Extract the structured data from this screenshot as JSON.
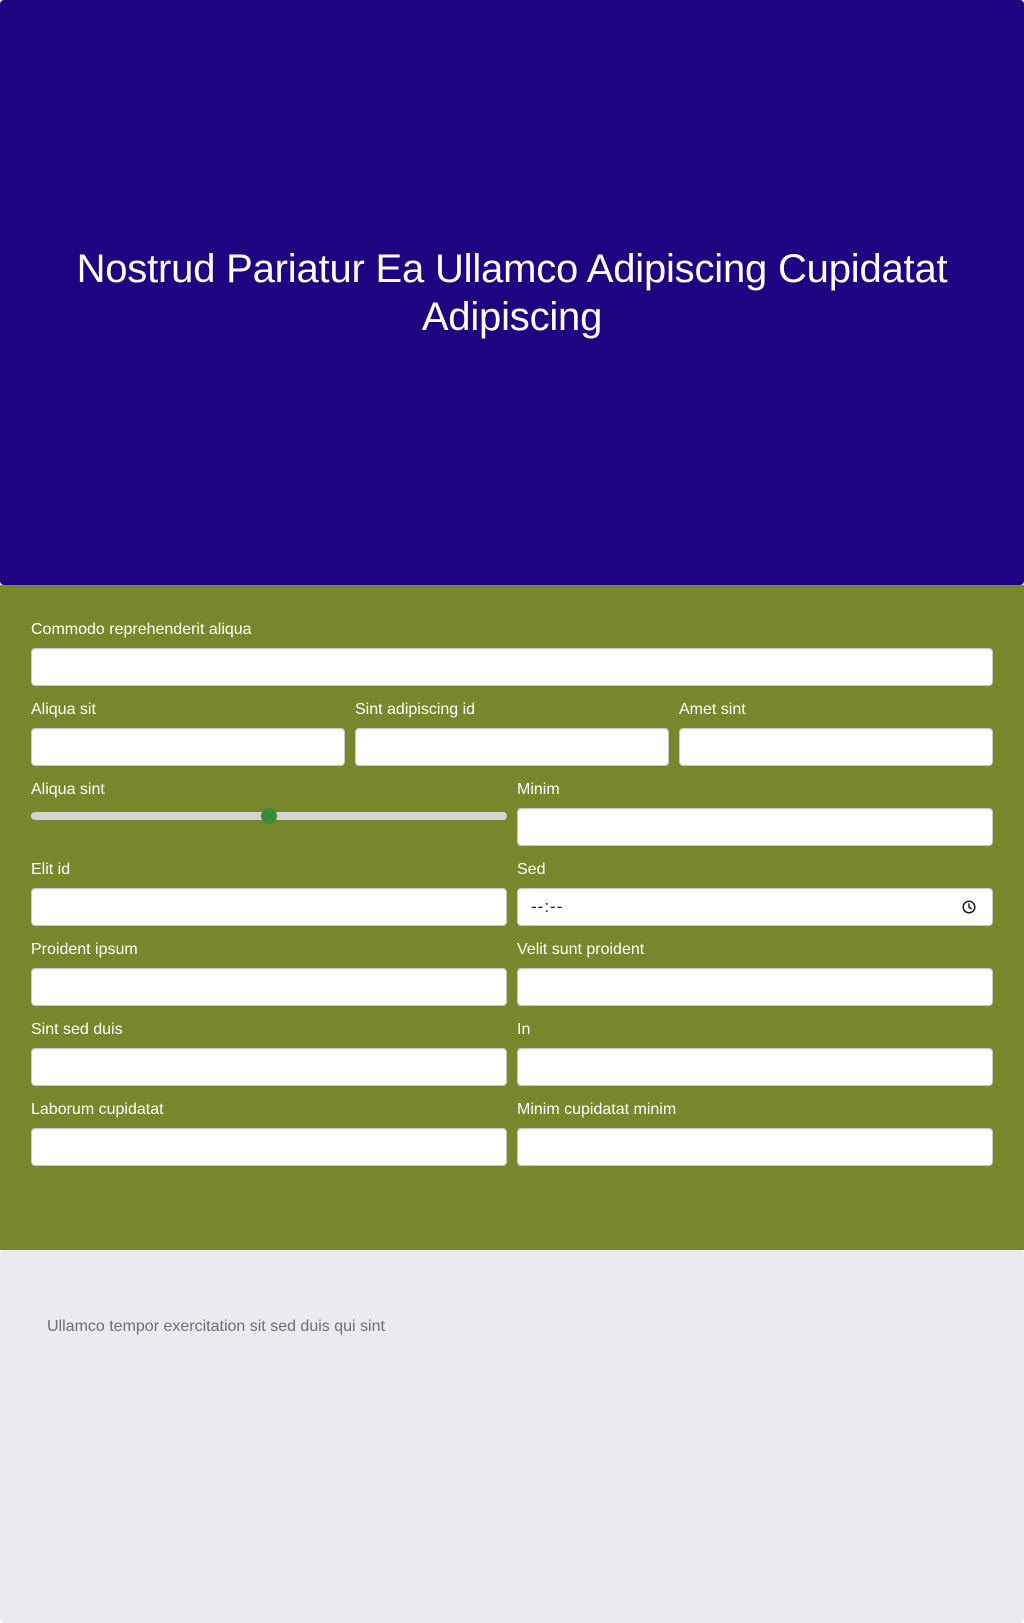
{
  "hero": {
    "title": "Nostrud Pariatur Ea Ullamco Adipiscing Cupidatat Adipiscing",
    "background": "#1e0481"
  },
  "form": {
    "background": "#76882b",
    "fields": {
      "commodo": {
        "label": "Commodo reprehenderit aliqua",
        "value": ""
      },
      "aliqua_sit": {
        "label": "Aliqua sit",
        "value": ""
      },
      "sint_adipiscing": {
        "label": "Sint adipiscing id",
        "value": ""
      },
      "amet_sint": {
        "label": "Amet sint",
        "value": ""
      },
      "aliqua_sint": {
        "label": "Aliqua sint",
        "slider_fraction": 0.5,
        "thumb_color": "#3b8a3a"
      },
      "minim": {
        "label": "Minim",
        "value": ""
      },
      "elit_id": {
        "label": "Elit id",
        "value": ""
      },
      "sed": {
        "label": "Sed",
        "value": "--:--",
        "icon": "clock-icon"
      },
      "proident_ipsum": {
        "label": "Proident ipsum",
        "value": ""
      },
      "velit_sunt": {
        "label": "Velit sunt proident",
        "value": ""
      },
      "sint_sed_duis": {
        "label": "Sint sed duis",
        "value": ""
      },
      "in": {
        "label": "In",
        "value": ""
      },
      "laborum": {
        "label": "Laborum cupidatat",
        "value": ""
      },
      "minim_cupidatat": {
        "label": "Minim cupidatat minim",
        "value": ""
      }
    }
  },
  "footer": {
    "text": "Ullamco tempor exercitation sit sed duis qui sint",
    "background": "#e9ebee"
  }
}
